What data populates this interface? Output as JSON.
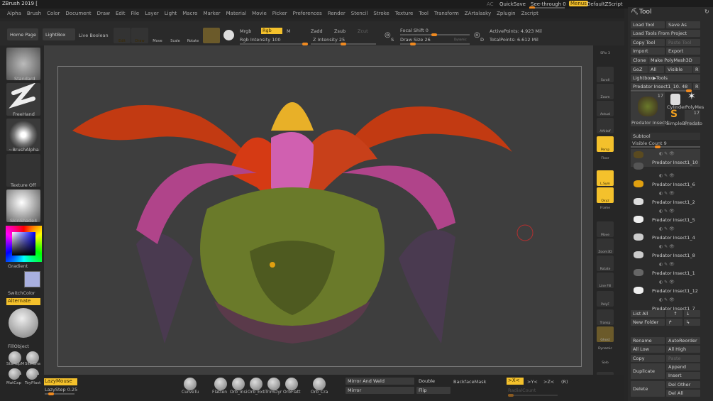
{
  "title": "ZBrush 2019 [",
  "titlebar": {
    "ac": "AC",
    "quicksave": "QuickSave",
    "see_through": "See-through 0",
    "menus": "Menus",
    "default_script": "DefaultZScript"
  },
  "menu": [
    "Alpha",
    "Brush",
    "Color",
    "Document",
    "Draw",
    "Edit",
    "File",
    "Layer",
    "Light",
    "Macro",
    "Marker",
    "Material",
    "Movie",
    "Picker",
    "Preferences",
    "Render",
    "Stencil",
    "Stroke",
    "Texture",
    "Tool",
    "Transform",
    "ZArtalasky",
    "Zplugin",
    "Zscript"
  ],
  "toolbar": {
    "home": "Home Page",
    "lightbox": "LightBox",
    "live_boolean": "Live Boolean",
    "edit": "Edit",
    "draw": "Draw",
    "move": "Move",
    "scale": "Scale",
    "rotate": "Rotate",
    "mrgb": "Mrgb",
    "rgb": "Rgb",
    "m": "M",
    "rgb_intensity": "Rgb Intensity 100",
    "zadd": "Zadd",
    "zsub": "Zsub",
    "zcut": "Zcut",
    "z_intensity": "Z Intensity 25",
    "focal_shift": "Focal Shift 0",
    "draw_size": "Draw Size 26",
    "dynamic": "Dynamic",
    "active_points": "ActivePoints: 4.923 Mil",
    "total_points": "TotalPoints: 6.612 Mil",
    "s": "S",
    "d": "D"
  },
  "left": {
    "brush": "Standard",
    "stroke": "FreeHand",
    "alpha": "~BrushAlpha",
    "texture": "Texture Off",
    "material": "SkinShade4",
    "gradient": "Gradient",
    "switch_color": "SwitchColor",
    "alternate": "Alternate",
    "fill_object": "FillObject",
    "mats": [
      "StartupM",
      "SkinSha",
      "MatCap",
      "ToyPlast"
    ],
    "color_secondary": "#a9b0e0"
  },
  "tray": [
    "SPix 3",
    "Scroll",
    "Zoom",
    "Actual",
    "AAHalf",
    "Persp",
    "Floor",
    "L.Sym",
    "Qxyz",
    "Frame",
    "Move",
    "Zoom3D",
    "Rotate",
    "Line Fill",
    "PolyF",
    "Transp",
    "Ghost",
    "Dynamic",
    "Solo",
    "Xpose"
  ],
  "panel": {
    "title": "Tool",
    "load_tool": "Load Tool",
    "save_as": "Save As",
    "load_from_project": "Load Tools From Project",
    "copy_tool": "Copy Tool",
    "paste_tool": "Paste Tool",
    "import": "Import",
    "export": "Export",
    "clone": "Clone",
    "make_polymesh": "Make PolyMesh3D",
    "goz": "GoZ",
    "all": "All",
    "visible": "Visible",
    "r": "R",
    "lightbox_tools": "Lightbox▶Tools",
    "current_tool": "Predator Insect1_10. 48",
    "tools": [
      {
        "name": "Predator Insect1",
        "count": "17"
      },
      {
        "name": "Cylinder"
      },
      {
        "name": "PolyMes"
      },
      {
        "name": "SimpleB"
      },
      {
        "name": "Predato",
        "count": "17"
      }
    ],
    "subtool": "Subtool",
    "visible_count": "Visible Count 9",
    "subtools": [
      "Predator Insect1_10",
      "Predator Insect1_6",
      "Predator Insect1_2",
      "Predator Insect1_5",
      "Predator Insect1_4",
      "Predator Insect1_8",
      "Predator Insect1_1",
      "Predator Insect1_12",
      "Predator Insect1_7"
    ],
    "list_all": "List All",
    "new_folder": "New Folder",
    "rename": "Rename",
    "auto_reorder": "AutoReorder",
    "all_low": "All Low",
    "all_high": "All High",
    "copy": "Copy",
    "paste": "Paste",
    "duplicate": "Duplicate",
    "append": "Append",
    "insert": "Insert",
    "delete": "Delete",
    "del_other": "Del Other",
    "del_all": "Del All"
  },
  "bottom": {
    "lazy_mouse": "LazyMouse",
    "lazy_step": "LazyStep 0.25",
    "brushes": [
      "CurveTu",
      "Flatten",
      "Orb_insi",
      "Orb_Exti",
      "TrimDyr",
      "OrbFlatt",
      "Orb_Cra"
    ],
    "mirror_weld": "Mirror And Weld",
    "mirror": "Mirror",
    "double": "Double",
    "flip": "Flip",
    "backface": "BackfaceMask",
    "x": ">X<",
    "y": ">Y<",
    "z": ">Z<",
    "r": "(R)",
    "radial": "RadialCount"
  },
  "colors": {
    "accent": "#f4c12c",
    "slider": "#f08a20"
  }
}
